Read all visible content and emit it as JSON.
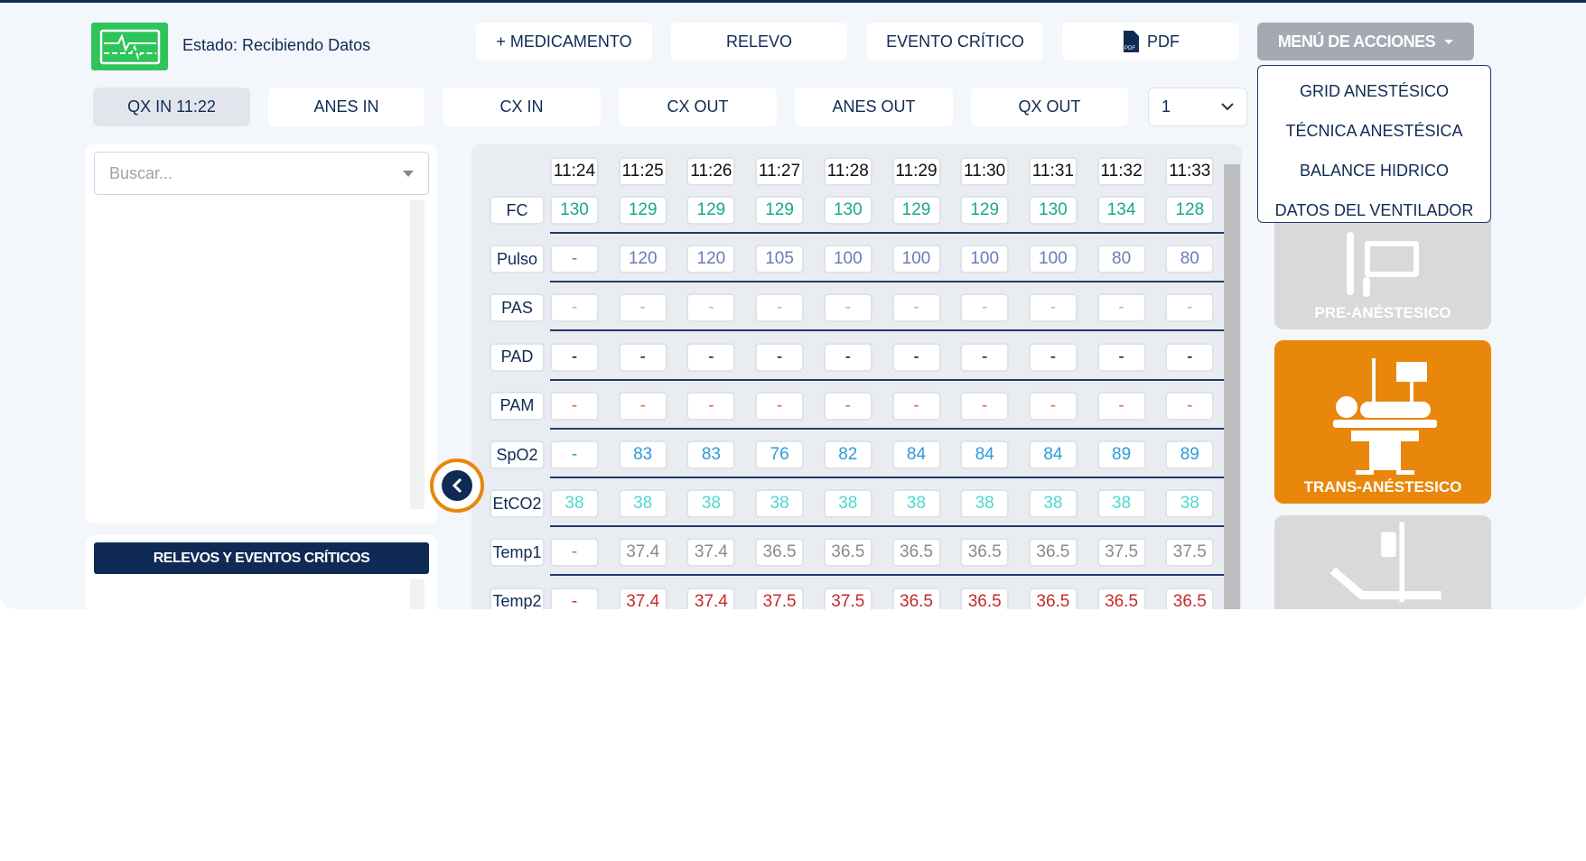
{
  "header": {
    "status": "Estado: Recibiendo Datos",
    "status_icon": "heart-monitor-icon",
    "status_color": "#2ec45a"
  },
  "toolbar": {
    "medicamento": "+ MEDICAMENTO",
    "relevo": "RELEVO",
    "evento": "EVENTO CRÍTICO",
    "pdf": "PDF",
    "menu": "MENÚ DE ACCIONES"
  },
  "menu_items": [
    "GRID ANESTÉSICO",
    "TÉCNICA ANESTÉSICA",
    "BALANCE HIDRICO",
    "DATOS DEL VENTILADOR"
  ],
  "timeline": {
    "qx_in": "QX IN 11:22",
    "anes_in": "ANES IN",
    "cx_in": "CX IN",
    "cx_out": "CX OUT",
    "anes_out": "ANES OUT",
    "qx_out": "QX OUT",
    "select_value": "1"
  },
  "search": {
    "placeholder": "Buscar..."
  },
  "relevos": {
    "title": "RELEVOS Y EVENTOS CRÍTICOS"
  },
  "grid": {
    "times": [
      "11:24",
      "11:25",
      "11:26",
      "11:27",
      "11:28",
      "11:29",
      "11:30",
      "11:31",
      "11:32",
      "11:33"
    ],
    "rows": [
      {
        "label": "FC",
        "color": "#17a88a",
        "values": [
          "130",
          "129",
          "129",
          "129",
          "130",
          "129",
          "129",
          "130",
          "134",
          "128"
        ]
      },
      {
        "label": "Pulso",
        "color": "#6a7bb8",
        "values": [
          "-",
          "120",
          "120",
          "105",
          "100",
          "100",
          "100",
          "100",
          "80",
          "80"
        ]
      },
      {
        "label": "PAS",
        "color": "#9bbbe3",
        "values": [
          "-",
          "-",
          "-",
          "-",
          "-",
          "-",
          "-",
          "-",
          "-",
          "-"
        ]
      },
      {
        "label": "PAD",
        "color": "#111111",
        "values": [
          "-",
          "-",
          "-",
          "-",
          "-",
          "-",
          "-",
          "-",
          "-",
          "-"
        ]
      },
      {
        "label": "PAM",
        "color": "#e8672a",
        "values": [
          "-",
          "-",
          "-",
          "-",
          "-",
          "-",
          "-",
          "-",
          "-",
          "-"
        ]
      },
      {
        "label": "SpO2",
        "color": "#2f9ad8",
        "values": [
          "-",
          "83",
          "83",
          "76",
          "82",
          "84",
          "84",
          "84",
          "89",
          "89"
        ]
      },
      {
        "label": "EtCO2",
        "color": "#4fd8d2",
        "values": [
          "38",
          "38",
          "38",
          "38",
          "38",
          "38",
          "38",
          "38",
          "38",
          "38"
        ]
      },
      {
        "label": "Temp1",
        "color": "#8a8a8a",
        "values": [
          "-",
          "37.4",
          "37.4",
          "36.5",
          "36.5",
          "36.5",
          "36.5",
          "36.5",
          "37.5",
          "37.5"
        ]
      },
      {
        "label": "Temp2",
        "color": "#c62828",
        "values": [
          "-",
          "37.4",
          "37.4",
          "37.5",
          "37.5",
          "36.5",
          "36.5",
          "36.5",
          "36.5",
          "36.5"
        ]
      }
    ]
  },
  "phases": {
    "pre": "PRE-ANÉSTESICO",
    "trans": "TRANS-ANÉSTESICO",
    "active": "trans",
    "active_color": "#e8870c"
  }
}
